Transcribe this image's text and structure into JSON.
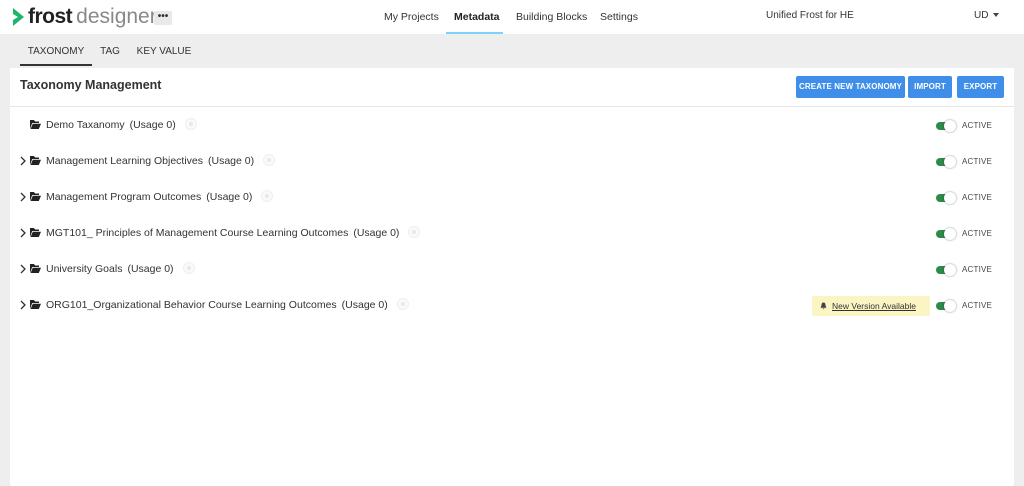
{
  "app": {
    "logo_text_bold": "frost",
    "logo_text_light": "designer",
    "more_label": "•••"
  },
  "nav": {
    "items": [
      {
        "label": "My Projects",
        "active": false
      },
      {
        "label": "Metadata",
        "active": true
      },
      {
        "label": "Building Blocks",
        "active": false
      },
      {
        "label": "Settings",
        "active": false
      }
    ],
    "org_name": "Unified Frost for HE",
    "user_initials": "UD"
  },
  "subtabs": [
    {
      "label": "TAXONOMY",
      "active": true
    },
    {
      "label": "TAG",
      "active": false
    },
    {
      "label": "KEY VALUE",
      "active": false
    }
  ],
  "panel": {
    "title": "Taxonomy Management",
    "buttons": {
      "create": "CREATE NEW TAXONOMY",
      "import": "IMPORT",
      "export": "EXPORT"
    }
  },
  "taxonomies": [
    {
      "name": "Demo Taxanomy",
      "usage": "(Usage 0)",
      "status": "ACTIVE",
      "expandable": false,
      "active": true
    },
    {
      "name": "Management Learning Objectives",
      "usage": "(Usage 0)",
      "status": "ACTIVE",
      "expandable": true,
      "active": true
    },
    {
      "name": "Management Program Outcomes",
      "usage": "(Usage 0)",
      "status": "ACTIVE",
      "expandable": true,
      "active": true
    },
    {
      "name": "MGT101_ Principles of Management Course Learning Outcomes",
      "usage": "(Usage 0)",
      "status": "ACTIVE",
      "expandable": true,
      "active": true
    },
    {
      "name": "University Goals",
      "usage": "(Usage 0)",
      "status": "ACTIVE",
      "expandable": true,
      "active": true
    },
    {
      "name": "ORG101_Organizational Behavior Course Learning Outcomes",
      "usage": "(Usage 0)",
      "status": "ACTIVE",
      "expandable": true,
      "active": true,
      "notice": "New Version Available"
    }
  ],
  "colors": {
    "primary_button": "#3f8ee9",
    "toggle_on": "#2f8a4a",
    "notice_bg": "#fbf5c4",
    "nav_active_underline": "#7dd3f7",
    "logo_green": "#1db56b"
  },
  "icons": {
    "logo": "chevron-right-logo",
    "more": "ellipsis-icon",
    "user_menu": "caret-down-icon",
    "row_expand": "chevron-right-icon",
    "folder": "folder-open-icon",
    "info": "info-icon",
    "notice": "bell-icon"
  }
}
